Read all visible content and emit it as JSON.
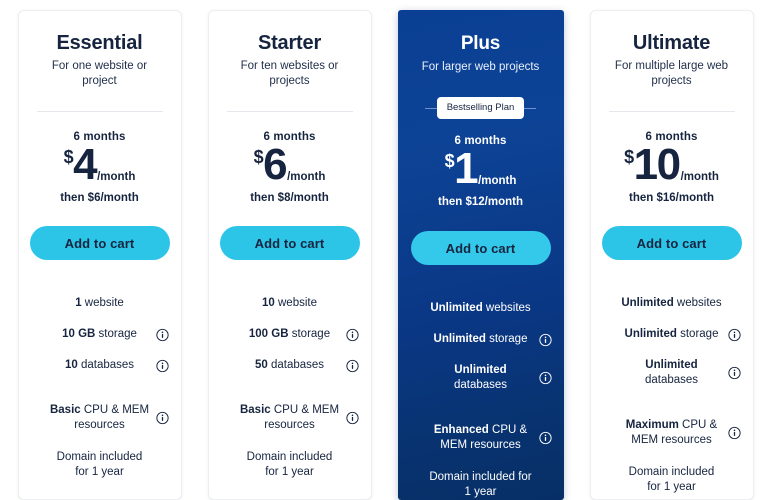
{
  "colors": {
    "accent_cyan": "#2cc5e8",
    "featured_blue_top": "#0a3f93",
    "featured_blue_bottom": "#072f66",
    "text_navy": "#16243f",
    "divider_gray": "#e4e7ec"
  },
  "cta_label": "Add to cart",
  "badge_label": "Bestselling Plan",
  "plans": [
    {
      "name": "Essential",
      "tagline": "For one website or project",
      "featured": false,
      "term": "6 months",
      "currency": "$",
      "amount": "4",
      "per": "/month",
      "then": "then $6/month",
      "features": [
        {
          "bold": "1",
          "rest": " website",
          "info": false
        },
        {
          "bold": "10 GB",
          "rest": " storage",
          "info": true
        },
        {
          "bold": "10",
          "rest": " databases",
          "info": true
        },
        {
          "bold": "Basic",
          "rest": " CPU & MEM resources",
          "info": true
        },
        {
          "bold": "",
          "rest": "Domain included for 1 year",
          "info": false
        }
      ]
    },
    {
      "name": "Starter",
      "tagline": "For ten websites or projects",
      "featured": false,
      "term": "6 months",
      "currency": "$",
      "amount": "6",
      "per": "/month",
      "then": "then $8/month",
      "features": [
        {
          "bold": "10",
          "rest": " website",
          "info": false
        },
        {
          "bold": "100 GB",
          "rest": " storage",
          "info": true
        },
        {
          "bold": "50",
          "rest": " databases",
          "info": true
        },
        {
          "bold": "Basic",
          "rest": " CPU & MEM resources",
          "info": true
        },
        {
          "bold": "",
          "rest": "Domain included for 1 year",
          "info": false
        }
      ]
    },
    {
      "name": "Plus",
      "tagline": "For larger web projects",
      "featured": true,
      "term": "6 months",
      "currency": "$",
      "amount": "1",
      "per": "/month",
      "then": "then $12/month",
      "features": [
        {
          "bold": "Unlimited",
          "rest": " websites",
          "info": false
        },
        {
          "bold": "Unlimited",
          "rest": " storage",
          "info": true
        },
        {
          "bold": "Unlimited",
          "rest": " databases",
          "info": true
        },
        {
          "bold": "Enhanced",
          "rest": " CPU & MEM resources",
          "info": true
        },
        {
          "bold": "",
          "rest": "Domain included for 1 year",
          "info": false
        }
      ]
    },
    {
      "name": "Ultimate",
      "tagline": "For multiple large web projects",
      "featured": false,
      "term": "6 months",
      "currency": "$",
      "amount": "10",
      "per": "/month",
      "then": "then $16/month",
      "features": [
        {
          "bold": "Unlimited",
          "rest": " websites",
          "info": false
        },
        {
          "bold": "Unlimited",
          "rest": " storage",
          "info": true
        },
        {
          "bold": "Unlimited",
          "rest": " databases",
          "info": true
        },
        {
          "bold": "Maximum",
          "rest": " CPU & MEM resources",
          "info": true
        },
        {
          "bold": "",
          "rest": "Domain included for 1 year",
          "info": false
        }
      ]
    }
  ]
}
